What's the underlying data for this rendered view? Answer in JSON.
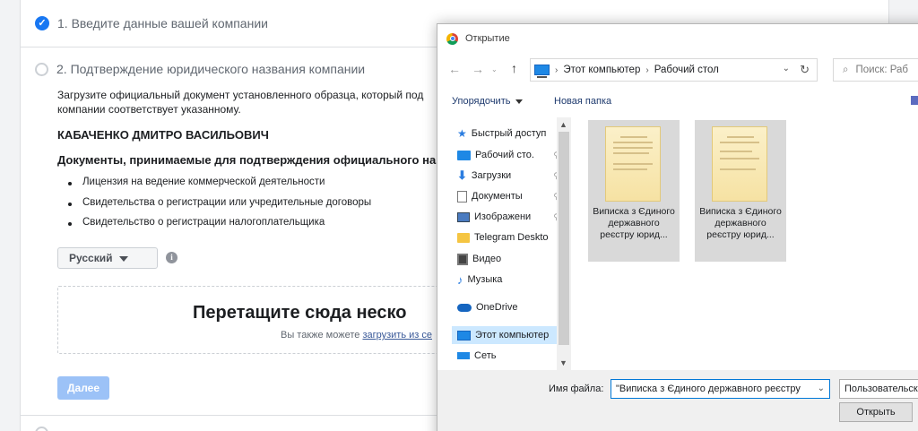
{
  "wizard": {
    "step1": {
      "title": "1. Введите данные вашей компании"
    },
    "step2": {
      "title": "2. Подтверждение юридического названия компании",
      "description": "Загрузите официальный документ установленного образца, который под компании соответствует указанному.",
      "company_name": "КАБАЧЕНКО ДМИТРО ВАСИЛЬОВИЧ",
      "docs_heading": "Документы, принимаемые для подтверждения официального назв",
      "docs": [
        "Лицензия на ведение коммерческой деятельности",
        "Свидетельства о регистрации или учредительные договоры",
        "Свидетельство о регистрации налогоплательщика"
      ],
      "language": "Русский",
      "info_glyph": "i",
      "drop_title": "Перетащите сюда неско",
      "drop_sub_prefix": "Вы также можете",
      "drop_sub_link": "загрузить из се",
      "next_label": "Далее"
    }
  },
  "dialog": {
    "title": "Открытие",
    "path": [
      "Этот компьютер",
      "Рабочий стол"
    ],
    "search_placeholder": "Поиск: Раб",
    "organize_label": "Упорядочить",
    "new_folder_label": "Новая папка",
    "nav_items": [
      {
        "label": "Быстрый доступ",
        "icon": "star-icon",
        "pinned": false
      },
      {
        "label": "Рабочий сто.",
        "icon": "desktop-icon",
        "pinned": true
      },
      {
        "label": "Загрузки",
        "icon": "download-icon",
        "pinned": true
      },
      {
        "label": "Документы",
        "icon": "document-icon",
        "pinned": true
      },
      {
        "label": "Изображени",
        "icon": "image-icon",
        "pinned": true
      },
      {
        "label": "Telegram Deskto",
        "icon": "folder-icon",
        "pinned": false
      },
      {
        "label": "Видео",
        "icon": "video-icon",
        "pinned": false
      },
      {
        "label": "Музыка",
        "icon": "music-icon",
        "pinned": false
      },
      {
        "label": "OneDrive",
        "icon": "cloud-icon",
        "pinned": false
      },
      {
        "label": "Этот компьютер",
        "icon": "computer-icon",
        "pinned": false,
        "selected": true
      },
      {
        "label": "Сеть",
        "icon": "network-icon",
        "pinned": false
      }
    ],
    "files": [
      {
        "name": "Виписка з Єдиного державного реєстру юрид..."
      },
      {
        "name": "Виписка з Єдиного державного реєстру юрид..."
      }
    ],
    "filename_label": "Имя файла:",
    "filename_value": "\"Виписка з Єдиного державного реєстру",
    "filter_value": "Пользовательск",
    "open_label": "Открыть"
  }
}
